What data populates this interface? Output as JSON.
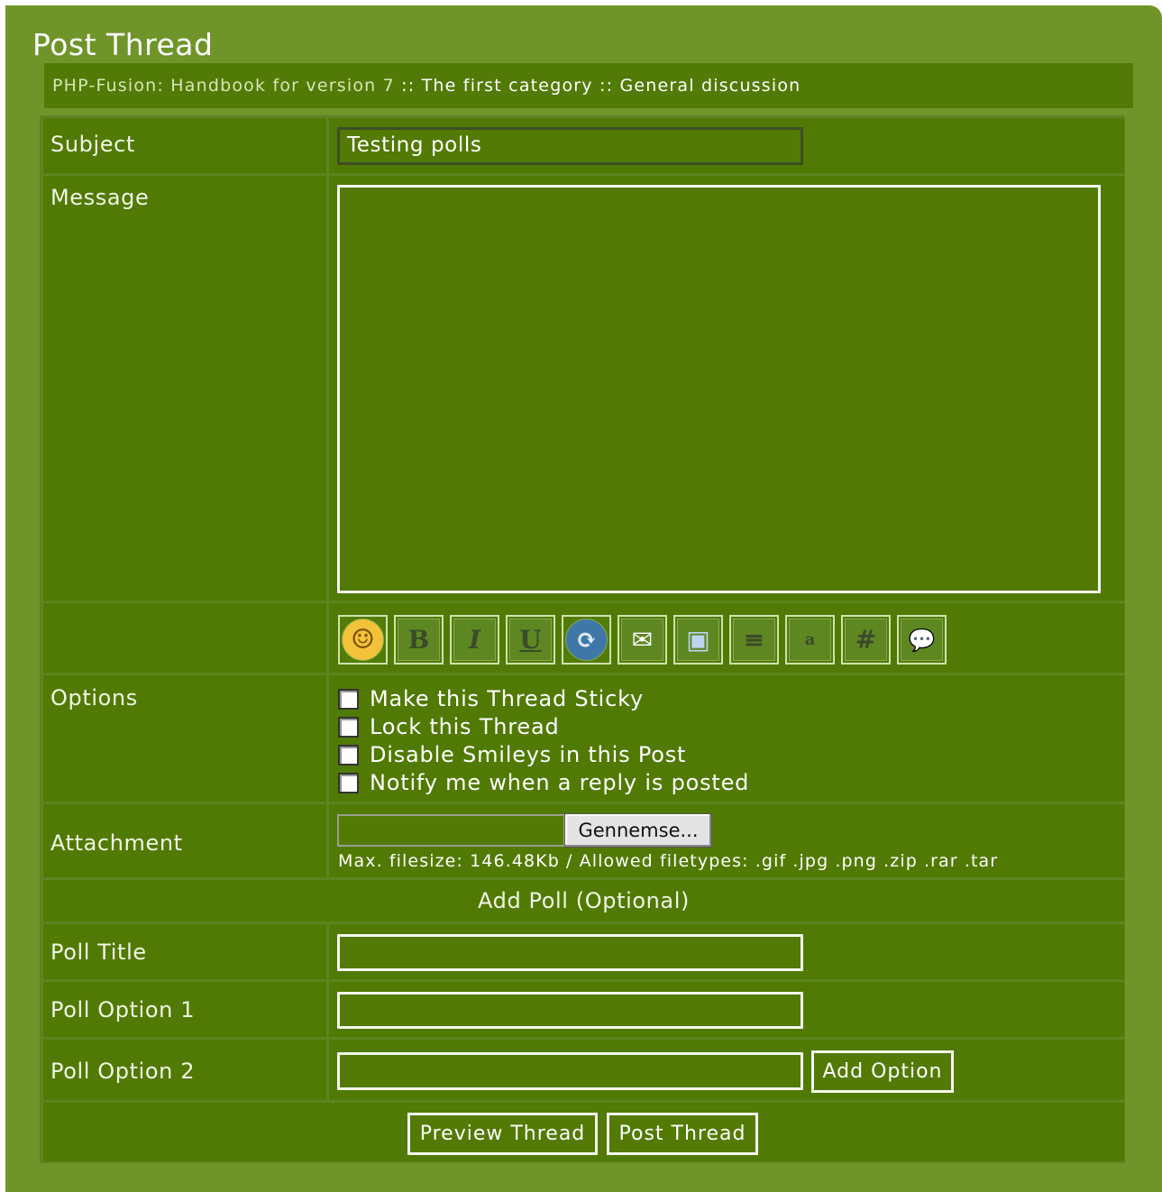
{
  "page": {
    "title": "Post Thread"
  },
  "breadcrumb": {
    "part1": "PHP-Fusion: Handbook for version 7",
    "sep1": " :: ",
    "part2": "The first category",
    "sep2": " :: ",
    "part3": "General discussion"
  },
  "form": {
    "subject_label": "Subject",
    "subject_value": "Testing polls",
    "message_label": "Message",
    "message_value": "",
    "toolbar": [
      {
        "name": "smiley-icon",
        "glyph": "☺"
      },
      {
        "name": "bold-icon",
        "glyph": "B"
      },
      {
        "name": "italic-icon",
        "glyph": "I"
      },
      {
        "name": "underline-icon",
        "glyph": "U"
      },
      {
        "name": "link-icon",
        "glyph": "⟳"
      },
      {
        "name": "email-icon",
        "glyph": "✉"
      },
      {
        "name": "image-icon",
        "glyph": "▣"
      },
      {
        "name": "align-icon",
        "glyph": "≡"
      },
      {
        "name": "small-text-icon",
        "glyph": "a"
      },
      {
        "name": "code-icon",
        "glyph": "#"
      },
      {
        "name": "quote-icon",
        "glyph": "💬"
      }
    ],
    "options_label": "Options",
    "options": [
      "Make this Thread Sticky",
      "Lock this Thread",
      "Disable Smileys in this Post",
      "Notify me when a reply is posted"
    ],
    "attachment_label": "Attachment",
    "browse_button": "Gennemse...",
    "attachment_note": "Max. filesize: 146.48Kb / Allowed filetypes: .gif .jpg .png .zip .rar .tar",
    "poll_header": "Add Poll (Optional)",
    "poll_title_label": "Poll Title",
    "poll_option1_label": "Poll Option 1",
    "poll_option2_label": "Poll Option 2",
    "add_option_button": "Add Option",
    "preview_button": "Preview Thread",
    "post_button": "Post Thread"
  },
  "colors": {
    "outer_panel": "#6f952a",
    "cell_bg": "#517a04",
    "grid_line": "#5c8420",
    "field_border": "#f4f7ee",
    "text": "#ffffff"
  }
}
